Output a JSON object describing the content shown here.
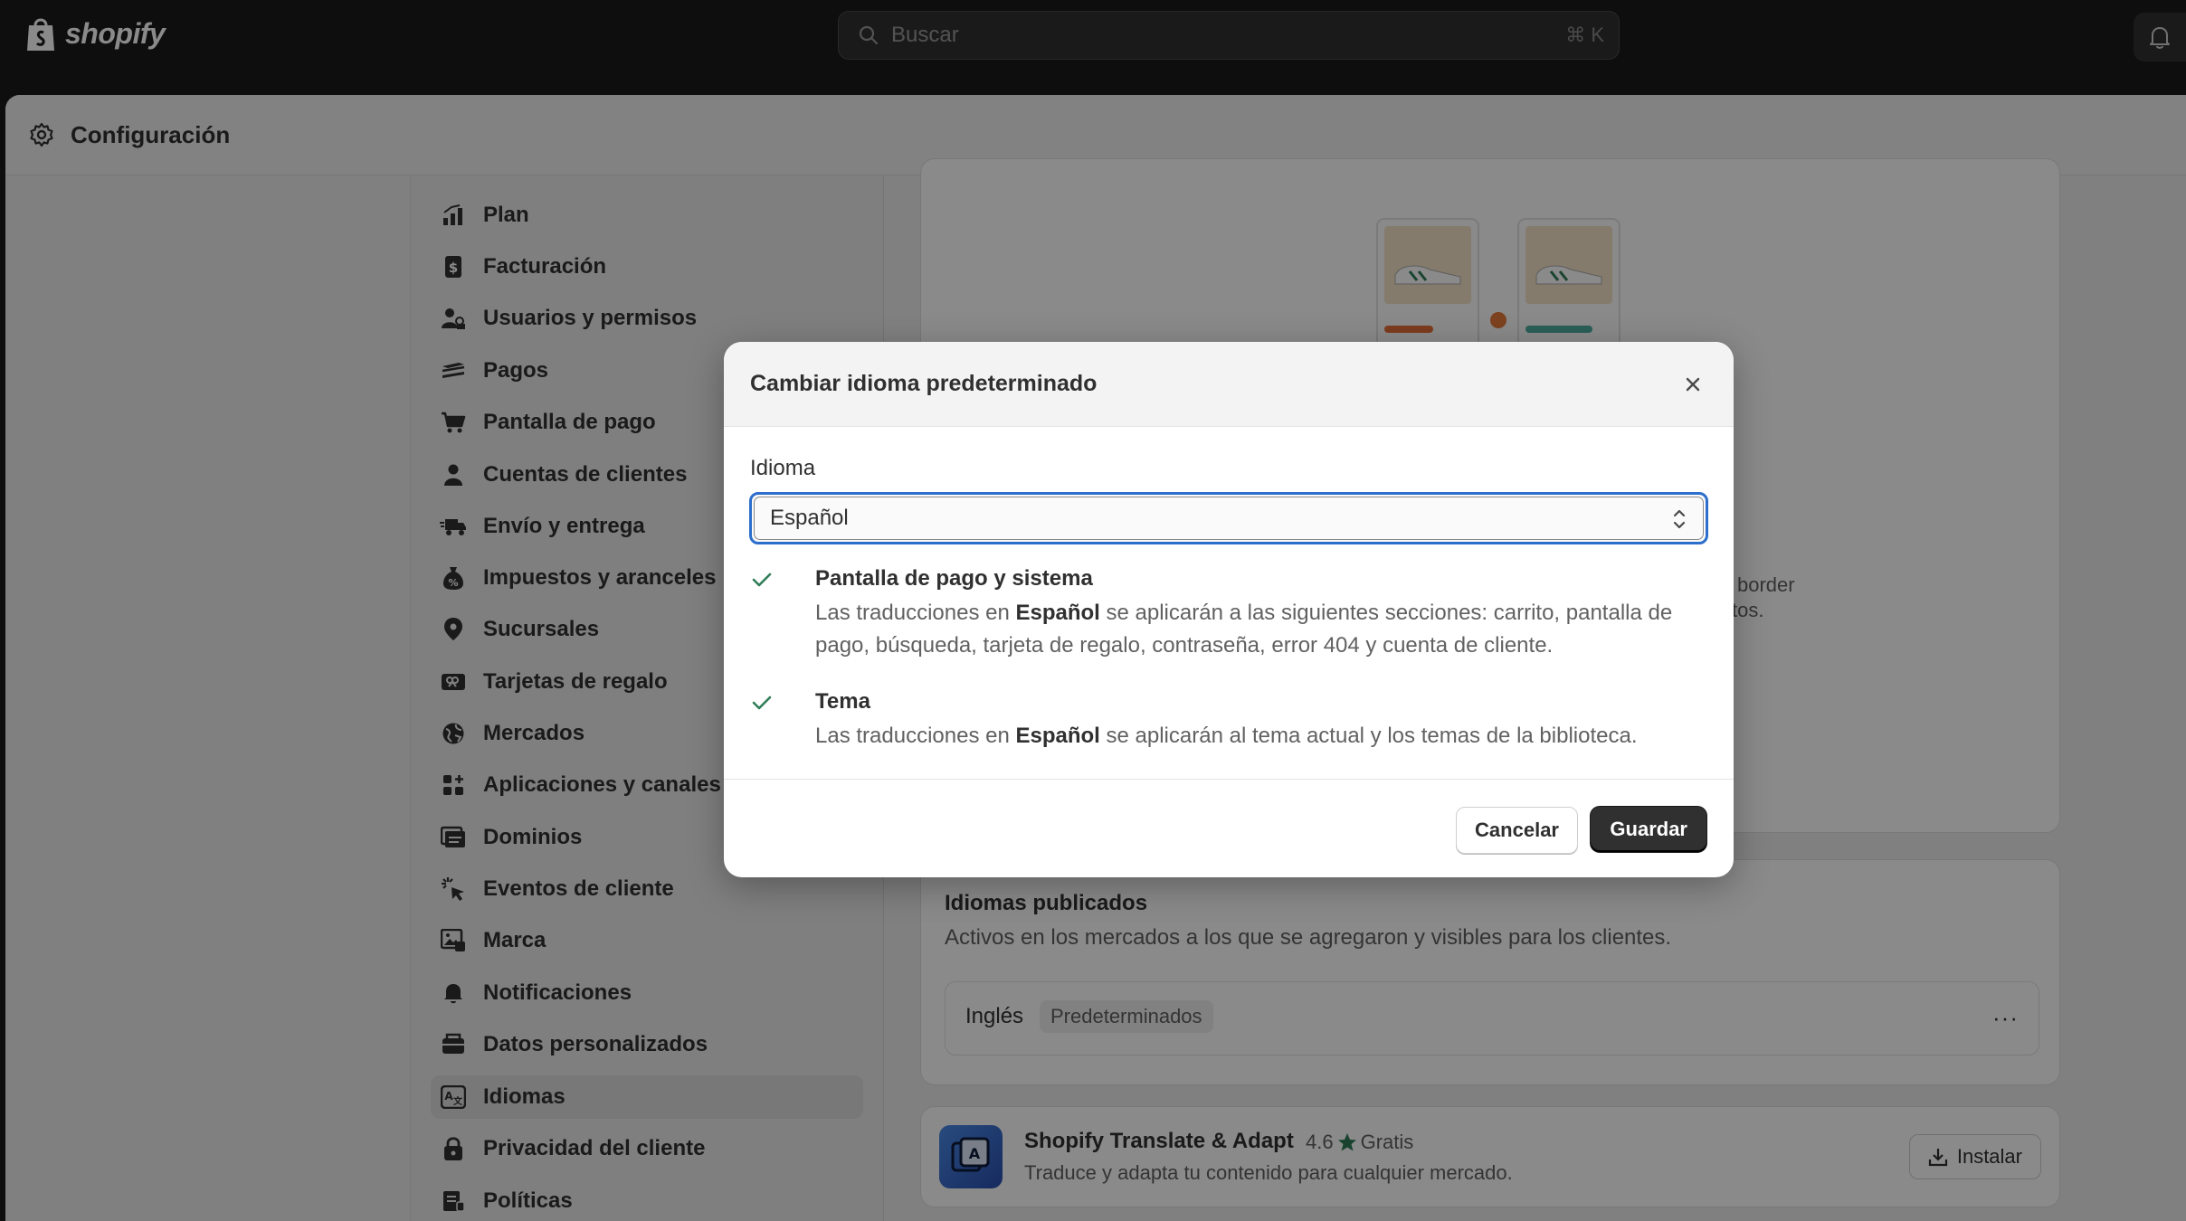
{
  "topbar": {
    "brand": "shopify",
    "search_placeholder": "Buscar",
    "search_shortcut": "⌘ K"
  },
  "panel": {
    "title": "Configuración"
  },
  "nav": {
    "items": [
      {
        "label": "Plan",
        "icon": "plan-icon"
      },
      {
        "label": "Facturación",
        "icon": "billing-icon"
      },
      {
        "label": "Usuarios y permisos",
        "icon": "users-icon"
      },
      {
        "label": "Pagos",
        "icon": "payments-icon"
      },
      {
        "label": "Pantalla de pago",
        "icon": "cart-icon"
      },
      {
        "label": "Cuentas de clientes",
        "icon": "customer-icon"
      },
      {
        "label": "Envío y entrega",
        "icon": "truck-icon"
      },
      {
        "label": "Impuestos y aranceles",
        "icon": "taxes-icon"
      },
      {
        "label": "Sucursales",
        "icon": "location-icon"
      },
      {
        "label": "Tarjetas de regalo",
        "icon": "gift-card-icon"
      },
      {
        "label": "Mercados",
        "icon": "globe-icon"
      },
      {
        "label": "Aplicaciones y canales de ventas",
        "icon": "apps-icon"
      },
      {
        "label": "Dominios",
        "icon": "domains-icon"
      },
      {
        "label": "Eventos de cliente",
        "icon": "cursor-icon"
      },
      {
        "label": "Marca",
        "icon": "brand-icon"
      },
      {
        "label": "Notificaciones",
        "icon": "bell-icon"
      },
      {
        "label": "Datos personalizados",
        "icon": "data-icon"
      },
      {
        "label": "Idiomas",
        "icon": "language-icon",
        "active": true
      },
      {
        "label": "Privacidad del cliente",
        "icon": "lock-icon"
      },
      {
        "label": "Políticas",
        "icon": "policies-icon"
      }
    ]
  },
  "background_snippets": {
    "line1": "border",
    "line2": "tos."
  },
  "published_languages": {
    "title": "Idiomas publicados",
    "subtitle": "Activos en los mercados a los que se agregaron y visibles para los clientes.",
    "language": "Inglés",
    "badge": "Predeterminados",
    "more": "···"
  },
  "app_card": {
    "name": "Shopify Translate & Adapt",
    "rating": "4.6",
    "price": "Gratis",
    "description": "Traduce y adapta tu contenido para cualquier mercado.",
    "install_label": "Instalar"
  },
  "modal": {
    "title": "Cambiar idioma predeterminado",
    "field_label": "Idioma",
    "selected_language": "Español",
    "sections": [
      {
        "title": "Pantalla de pago y sistema",
        "text_before": "Las traducciones en ",
        "language": "Español",
        "text_after": " se aplicarán a las siguientes secciones: carrito, pantalla de pago, búsqueda, tarjeta de regalo, contraseña, error 404 y cuenta de cliente."
      },
      {
        "title": "Tema",
        "text_before": "Las traducciones en ",
        "language": "Español",
        "text_after": " se aplicarán al tema actual y los temas de la biblioteca."
      }
    ],
    "cancel_label": "Cancelar",
    "save_label": "Guardar"
  },
  "colors": {
    "accent_focus": "#2c6ecb",
    "check_green": "#2f7d58",
    "primary_button": "#303030",
    "star": "#2f7d58"
  }
}
